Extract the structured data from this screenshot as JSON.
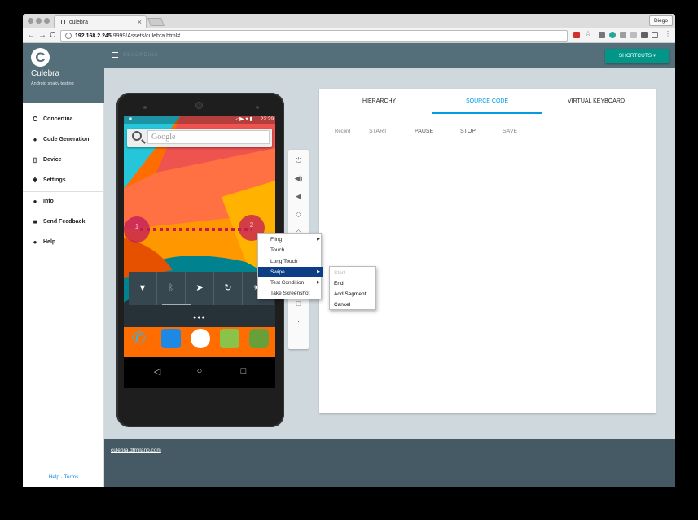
{
  "browser": {
    "tab_title": "culebra",
    "tab_close": "×",
    "user": "Diego",
    "url_host": "192.168.2.245",
    "url_rest": ":9999/Assets/culebra.html#",
    "back": "←",
    "forward": "→",
    "reload": "C"
  },
  "sidebar": {
    "logo_letter": "C",
    "brand": "Culebra",
    "tagline": "Android snaky testing",
    "items": [
      {
        "label": "Concertina",
        "icon": "culebra-icon"
      },
      {
        "label": "Code Generation",
        "icon": "dot-icon"
      },
      {
        "label": "Device",
        "icon": "phone-icon"
      },
      {
        "label": "Settings",
        "icon": "gear-icon"
      },
      {
        "label": "Info",
        "icon": "info-icon"
      },
      {
        "label": "Send Feedback",
        "icon": "feedback-icon"
      },
      {
        "label": "Help",
        "icon": "help-icon"
      }
    ],
    "footer": "Help · Terms"
  },
  "topbar": {
    "recording": "RECORDING",
    "shortcuts": "SHORTCUTS ▾"
  },
  "device": {
    "clock": "22:29",
    "status_icons": "◁▶ ▾ ▮",
    "search_placeholder": "Google",
    "point1": "1",
    "point2": "2",
    "quick_settings": [
      "wifi-icon",
      "bluetooth-icon",
      "location-icon",
      "rotate-icon",
      "settings-icon"
    ],
    "nav": [
      "◁",
      "○",
      "□"
    ]
  },
  "tools": [
    "power-icon",
    "volume-up-icon",
    "volume-down-icon",
    "rotate-left-icon",
    "rotate-right-icon",
    "back-icon",
    "home-icon",
    "recents-icon",
    "more-icon"
  ],
  "panel": {
    "tabs": [
      "HIERARCHY",
      "SOURCE CODE",
      "VIRTUAL KEYBOARD"
    ],
    "active_tab": "SOURCE CODE",
    "record_label": "Record",
    "buttons": [
      "START",
      "PAUSE",
      "STOP",
      "SAVE"
    ]
  },
  "context_menu": {
    "items": [
      {
        "label": "Fling",
        "submenu": true
      },
      {
        "label": "Touch",
        "submenu": false
      },
      {
        "label": "Long Touch",
        "submenu": false
      },
      {
        "label": "Swipe",
        "submenu": true,
        "selected": true
      },
      {
        "label": "Test Condition",
        "submenu": true
      },
      {
        "label": "Take Screenshot",
        "submenu": false
      }
    ],
    "swipe_submenu": [
      {
        "label": "Start",
        "disabled": true
      },
      {
        "label": "End",
        "disabled": false
      },
      {
        "label": "Add Segment",
        "disabled": false
      },
      {
        "label": "Cancel",
        "disabled": false
      }
    ]
  },
  "footer": {
    "link": "culebra.dtmilano.com"
  },
  "colors": {
    "header": "#546e7a",
    "accent": "#009688",
    "tab_underline": "#039be5",
    "menu_selected": "#0b3e85",
    "swipe_point": "#c2185b"
  }
}
